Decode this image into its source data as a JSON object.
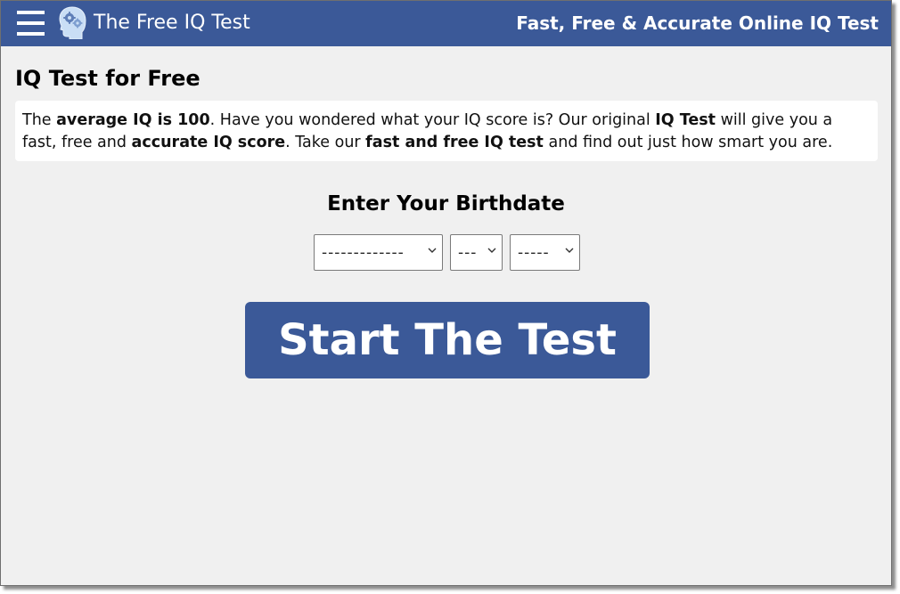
{
  "header": {
    "menu_icon": "hamburger-menu-icon",
    "logo_icon": "brain-gears-head-icon",
    "site_title": "The Free IQ Test",
    "tagline": "Fast, Free & Accurate Online IQ Test"
  },
  "main": {
    "page_title": "IQ Test for Free",
    "intro": {
      "t1": "The ",
      "b1": "average IQ is 100",
      "t2": ". Have you wondered what your IQ score is? Our original ",
      "b2": "IQ Test",
      "t3": " will give you a fast, free and ",
      "b3": "accurate IQ score",
      "t4": ". Take our ",
      "b4": "fast and free IQ test",
      "t5": " and find out just how smart you are."
    },
    "birthdate": {
      "heading": "Enter Your Birthdate",
      "month_value": "-------------",
      "day_value": "---",
      "year_value": "-----"
    },
    "start_button": "Start The Test"
  },
  "colors": {
    "header_bg": "#3b5998",
    "button_bg": "#3b5998",
    "page_bg": "#f0f0f0",
    "text": "#000000"
  }
}
